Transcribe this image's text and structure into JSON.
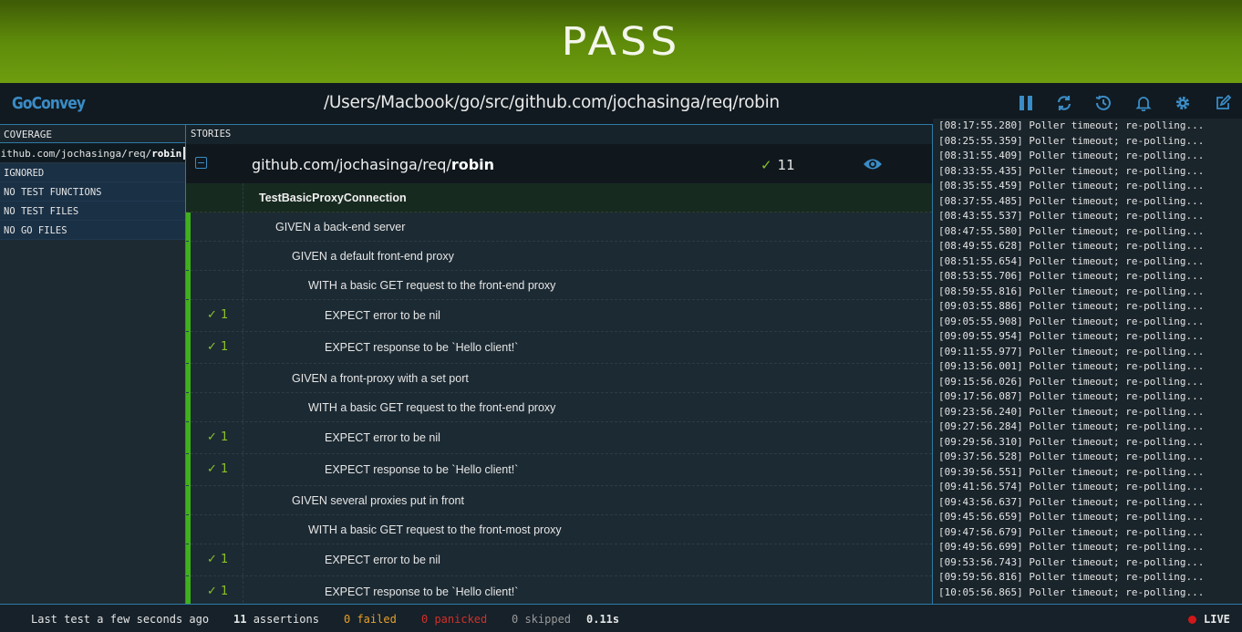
{
  "banner": {
    "status": "PASS"
  },
  "header": {
    "logo": "GoConvey",
    "path": "/Users/Macbook/go/src/github.com/jochasinga/req/robin",
    "controls": [
      {
        "name": "pause-icon"
      },
      {
        "name": "refresh-icon"
      },
      {
        "name": "history-icon"
      },
      {
        "name": "bell-icon"
      },
      {
        "name": "gear-icon"
      },
      {
        "name": "edit-icon"
      }
    ]
  },
  "coverage": {
    "header": "COVERAGE",
    "package_prefix": "github.com/jochasinga/req/",
    "package_name": "robin",
    "items": [
      "IGNORED",
      "NO TEST FUNCTIONS",
      "NO TEST FILES",
      "NO GO FILES"
    ]
  },
  "stories": {
    "header": "STORIES",
    "package_prefix": "github.com/jochasinga/req/",
    "package_name": "robin",
    "package_checkmark": "✓",
    "package_count": "11",
    "rows": [
      {
        "text": "TestBasicProxyConnection",
        "level": 0,
        "type": "test"
      },
      {
        "text": "GIVEN a back-end server",
        "level": 1
      },
      {
        "text": "GIVEN a default front-end proxy",
        "level": 2
      },
      {
        "text": "WITH a basic GET request to the front-end proxy",
        "level": 3
      },
      {
        "text": "EXPECT error to be nil",
        "level": 4,
        "check": "✓ 1"
      },
      {
        "text": "EXPECT response to be `Hello client!`",
        "level": 4,
        "check": "✓ 1"
      },
      {
        "text": "GIVEN a front-proxy with a set port",
        "level": 2
      },
      {
        "text": "WITH a basic GET request to the front-end proxy",
        "level": 3
      },
      {
        "text": "EXPECT error to be nil",
        "level": 4,
        "check": "✓ 1"
      },
      {
        "text": "EXPECT response to be `Hello client!`",
        "level": 4,
        "check": "✓ 1"
      },
      {
        "text": "GIVEN several proxies put in front",
        "level": 2
      },
      {
        "text": "WITH a basic GET request to the front-most proxy",
        "level": 3
      },
      {
        "text": "EXPECT error to be nil",
        "level": 4,
        "check": "✓ 1"
      },
      {
        "text": "EXPECT response to be `Hello client!`",
        "level": 4,
        "check": "✓ 1"
      }
    ]
  },
  "log": {
    "lines": [
      "[08:17:55.280] Poller timeout; re-polling...",
      "[08:25:55.359] Poller timeout; re-polling...",
      "[08:31:55.409] Poller timeout; re-polling...",
      "[08:33:55.435] Poller timeout; re-polling...",
      "[08:35:55.459] Poller timeout; re-polling...",
      "[08:37:55.485] Poller timeout; re-polling...",
      "[08:43:55.537] Poller timeout; re-polling...",
      "[08:47:55.580] Poller timeout; re-polling...",
      "[08:49:55.628] Poller timeout; re-polling...",
      "[08:51:55.654] Poller timeout; re-polling...",
      "[08:53:55.706] Poller timeout; re-polling...",
      "[08:59:55.816] Poller timeout; re-polling...",
      "[09:03:55.886] Poller timeout; re-polling...",
      "[09:05:55.908] Poller timeout; re-polling...",
      "[09:09:55.954] Poller timeout; re-polling...",
      "[09:11:55.977] Poller timeout; re-polling...",
      "[09:13:56.001] Poller timeout; re-polling...",
      "[09:15:56.026] Poller timeout; re-polling...",
      "[09:17:56.087] Poller timeout; re-polling...",
      "[09:23:56.240] Poller timeout; re-polling...",
      "[09:27:56.284] Poller timeout; re-polling...",
      "[09:29:56.310] Poller timeout; re-polling...",
      "[09:37:56.528] Poller timeout; re-polling...",
      "[09:39:56.551] Poller timeout; re-polling...",
      "[09:41:56.574] Poller timeout; re-polling...",
      "[09:43:56.637] Poller timeout; re-polling...",
      "[09:45:56.659] Poller timeout; re-polling...",
      "[09:47:56.679] Poller timeout; re-polling...",
      "[09:49:56.699] Poller timeout; re-polling...",
      "[09:53:56.743] Poller timeout; re-polling...",
      "[09:59:56.816] Poller timeout; re-polling...",
      "[10:05:56.865] Poller timeout; re-polling..."
    ]
  },
  "footer": {
    "last_test": "Last test a few seconds ago",
    "assertions_count": "11",
    "assertions_label": "assertions",
    "failed": "0 failed",
    "panicked": "0 panicked",
    "skipped": "0 skipped",
    "time": "0.11s",
    "live": "LIVE",
    "colors": {
      "failed": "#e8a02c",
      "panicked": "#d0302b",
      "live_dot": "#d01818"
    }
  }
}
